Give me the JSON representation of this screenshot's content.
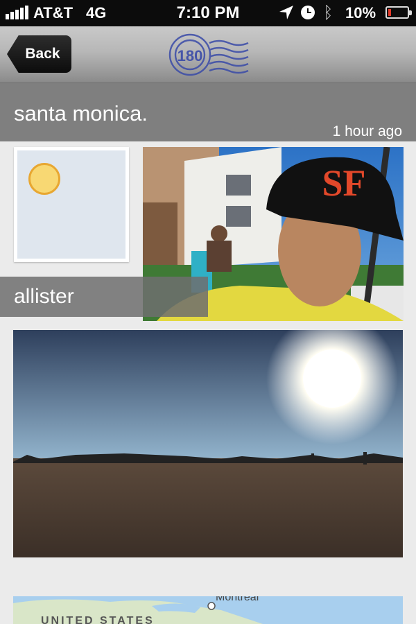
{
  "status_bar": {
    "carrier": "AT&T",
    "network": "4G",
    "time": "7:10 PM",
    "battery": "10%",
    "battery_level": 0.1,
    "icons": [
      "signal-icon",
      "location-arrow-icon",
      "clock-icon",
      "bluetooth-icon",
      "battery-icon"
    ]
  },
  "nav": {
    "back_label": "Back",
    "logo_text": "180"
  },
  "post": {
    "place": "santa monica.",
    "time_ago": "1 hour ago",
    "username": "allister"
  },
  "map": {
    "city_label": "Montreal",
    "country_label": "UNITED STATES"
  },
  "colors": {
    "title_band": "#7f7f7f",
    "nav_bar": "#b7b7b7",
    "avatar_dot": "#f8d873",
    "avatar_bg": "#dfe6ee"
  }
}
